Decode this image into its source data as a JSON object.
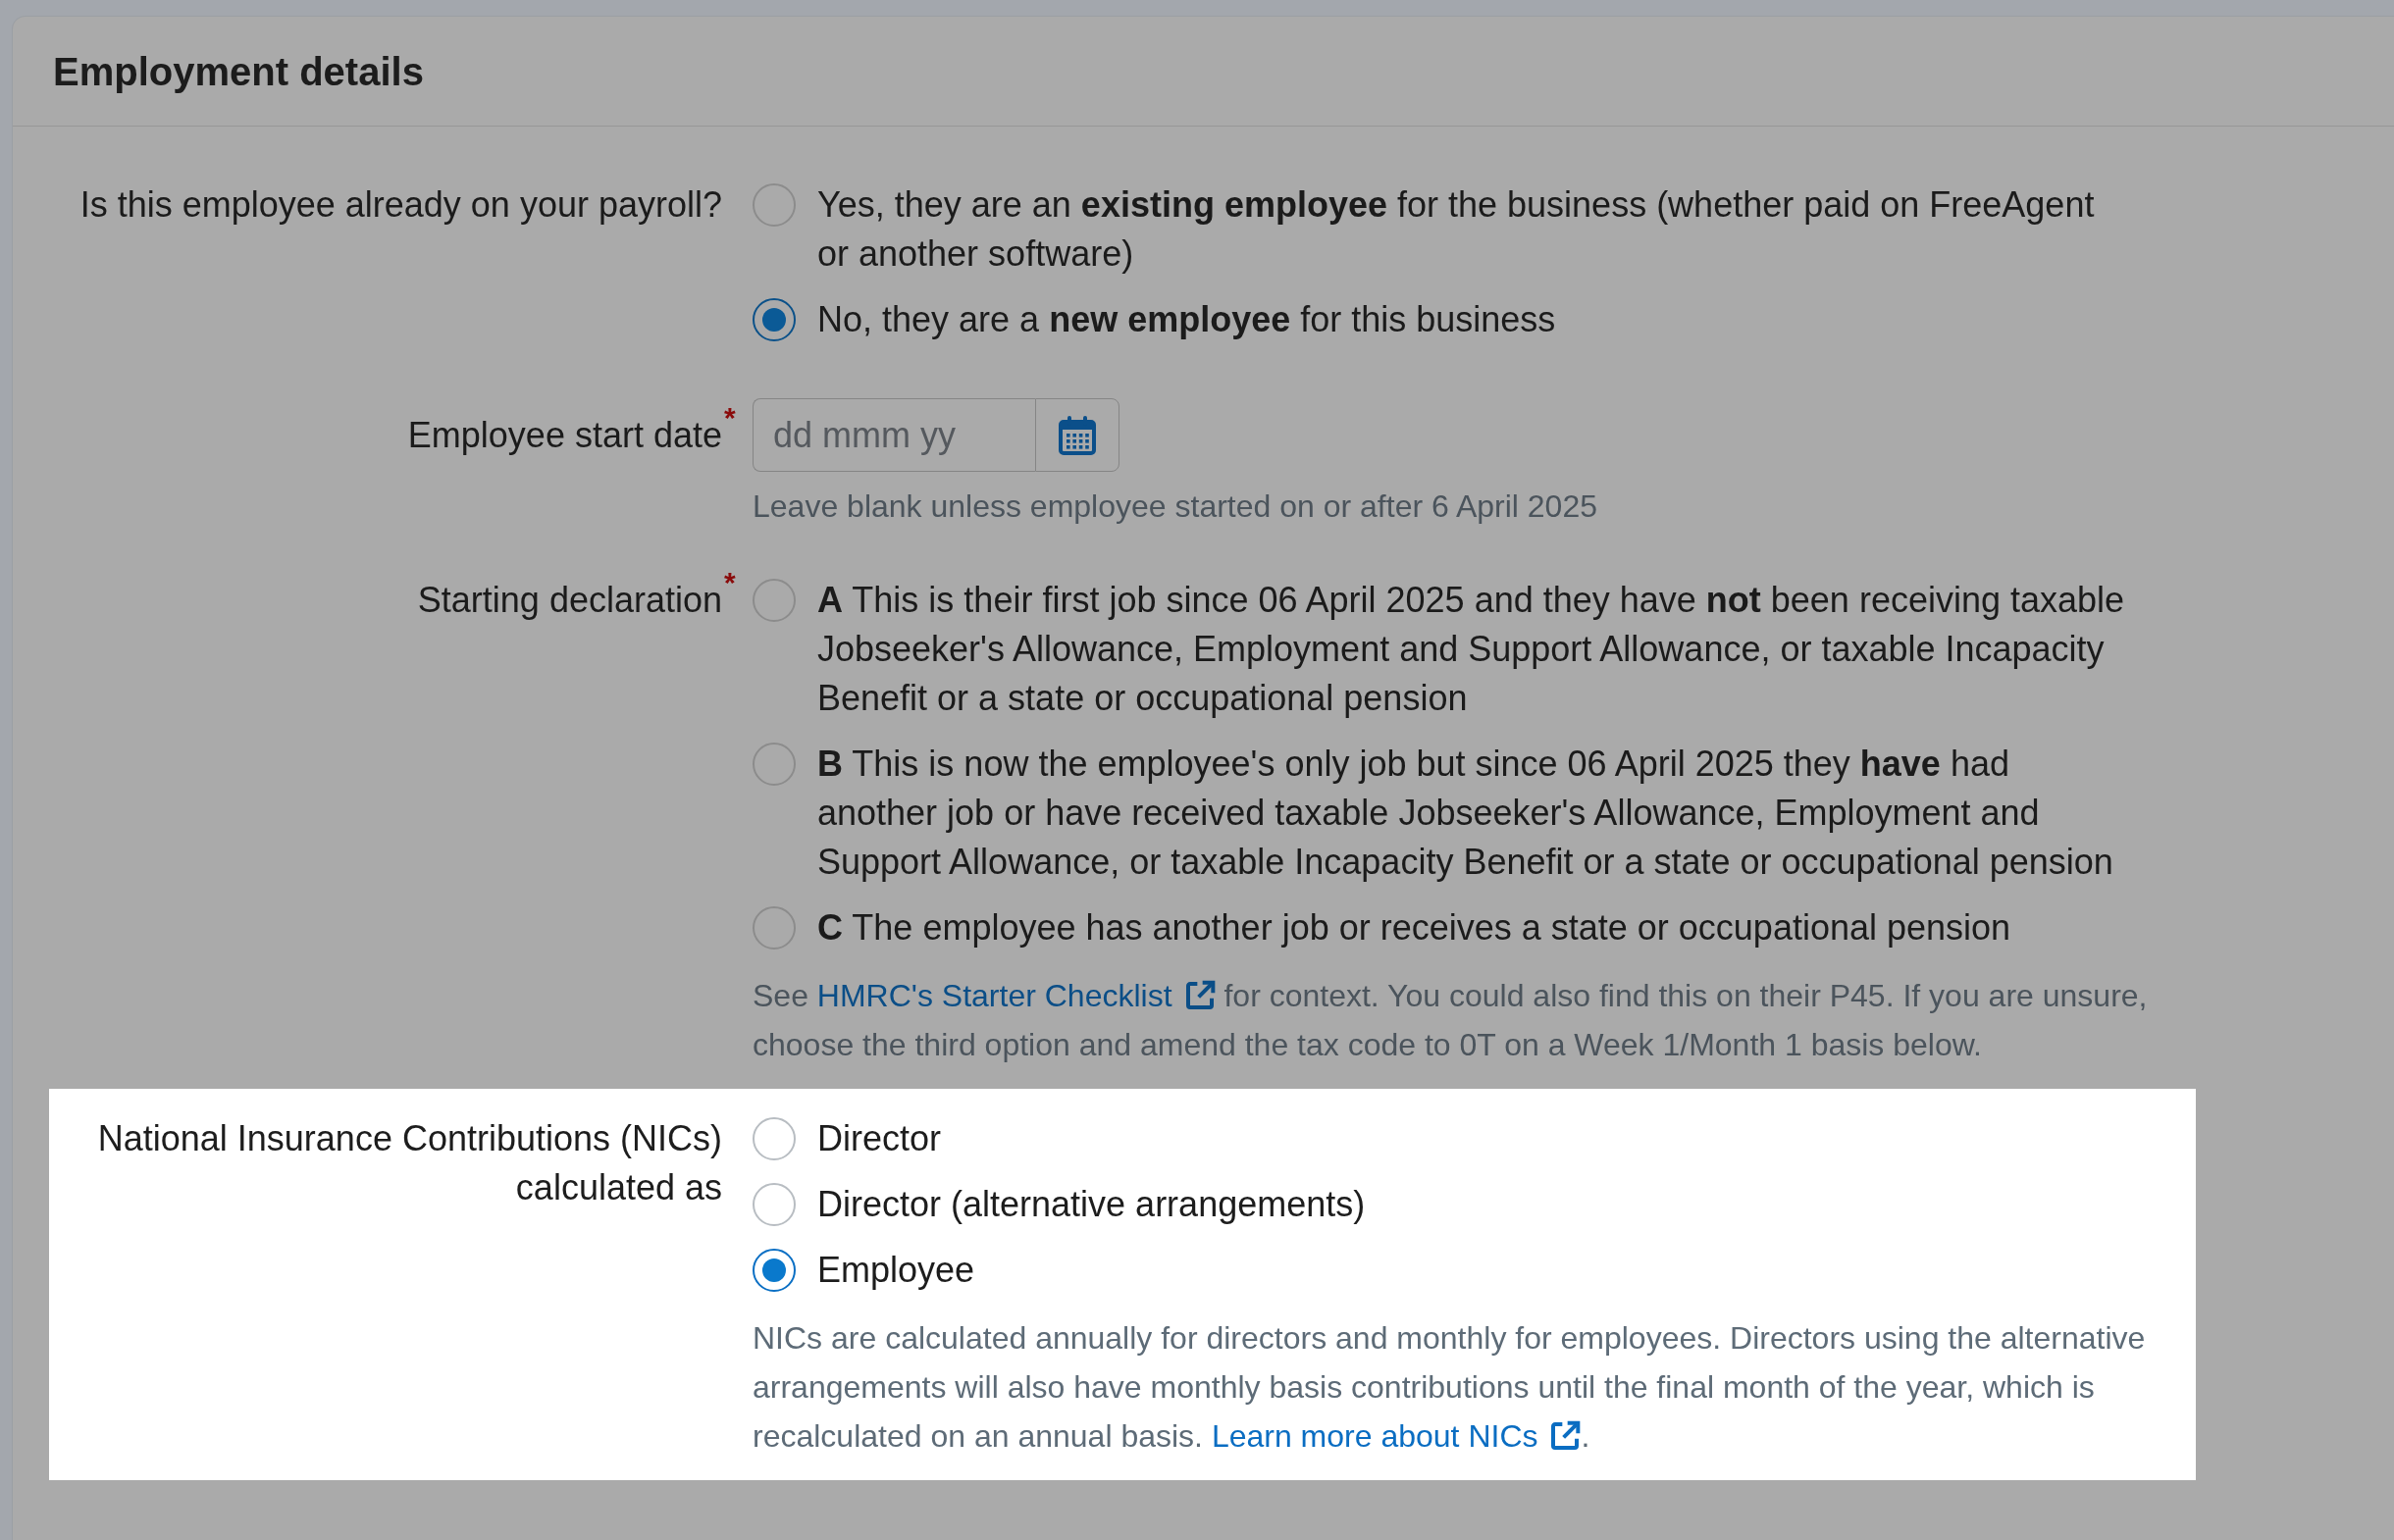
{
  "section": {
    "title": "Employment details"
  },
  "fields": [
    {
      "kind": "radio",
      "label": "Is this employee already on your payroll?",
      "highlighted": false,
      "options": [
        {
          "text": "Yes, they are an **existing employee** for the business (whether paid on FreeAgent or another software)",
          "selected": false
        },
        {
          "text": "No, they are a **new employee** for this business",
          "selected": true
        }
      ]
    },
    {
      "kind": "date",
      "label": "Employee start date",
      "required_mark": "*",
      "highlighted": false,
      "placeholder": "dd mmm yy",
      "hint": {
        "text": "Leave blank unless employee started on or after 6 April 2025"
      }
    },
    {
      "kind": "radio",
      "label": "Starting declaration",
      "required_mark": "*",
      "highlighted": false,
      "options": [
        {
          "text": "**A** This is their first job since 06 April 2025 and they have **not** been receiving taxable Jobseeker's Allowance, Employment and Support Allowance, or taxable Incapacity Benefit or a state or occupational pension",
          "selected": false
        },
        {
          "text": "**B** This is now the employee's only job but since 06 April 2025 they **have** had another job or have received taxable Jobseeker's Allowance, Employment and Support Allowance, or taxable Incapacity Benefit or a state or occupational pension",
          "selected": false
        },
        {
          "text": "**C** The employee has another job or receives a state or occupational pension",
          "selected": false
        }
      ],
      "hint": {
        "text": "See ",
        "link": "HMRC's Starter Checklist",
        "after": " for context. You could also find this on their P45. If you are unsure, choose the third option and amend the tax code to 0T on a Week 1/Month 1 basis below."
      }
    },
    {
      "kind": "radio",
      "label": "National Insurance Contributions (NICs) calculated as",
      "highlighted": true,
      "options": [
        {
          "text": "Director",
          "selected": false
        },
        {
          "text": "Director (alternative arrangements)",
          "selected": false
        },
        {
          "text": "Employee",
          "selected": true
        }
      ],
      "hint": {
        "text": "NICs are calculated annually for directors and monthly for employees. Directors using the alternative arrangements will also have monthly basis contributions until the final month of the year, which is recalculated on an annual basis. ",
        "link": "Learn more about NICs",
        "after": "."
      }
    }
  ]
}
